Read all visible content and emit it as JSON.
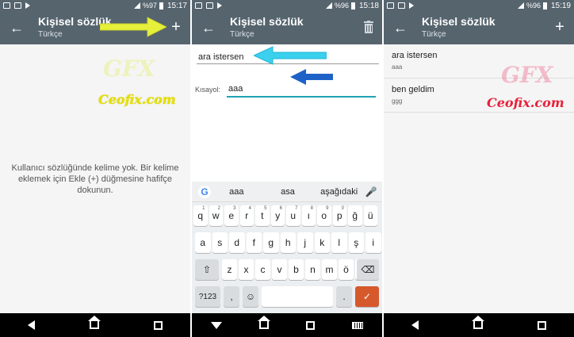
{
  "screens": [
    {
      "status": {
        "battery": "%97",
        "time": "15:17"
      },
      "title": "Kişisel sözlük",
      "subtitle": "Türkçe",
      "action": "+",
      "empty_message": "Kullanıcı sözlüğünde kelime yok. Bir kelime eklemek için Ekle (+) düğmesine hafifçe dokunun."
    },
    {
      "status": {
        "battery": "%96",
        "time": "15:18"
      },
      "title": "Kişisel sözlük",
      "subtitle": "Türkçe",
      "word_value": "ara istersen",
      "shortcut_label": "Kısayol:",
      "shortcut_value": "aaa",
      "suggestions": [
        "aaa",
        "asa",
        "aşağıdaki"
      ],
      "keyboard": {
        "row1": [
          "q",
          "w",
          "e",
          "r",
          "t",
          "y",
          "u",
          "ı",
          "o",
          "p",
          "ğ",
          "ü"
        ],
        "row1_hints": [
          "1",
          "2",
          "3",
          "4",
          "5",
          "6",
          "7",
          "8",
          "9",
          "0",
          "",
          ""
        ],
        "row2": [
          "a",
          "s",
          "d",
          "f",
          "g",
          "h",
          "j",
          "k",
          "l",
          "ş",
          "i"
        ],
        "row3": [
          "z",
          "x",
          "c",
          "v",
          "b",
          "n",
          "m",
          "ö",
          "ç"
        ],
        "symbols": "?123",
        "comma": ",",
        "period": "."
      }
    },
    {
      "status": {
        "battery": "%96",
        "time": "15:19"
      },
      "title": "Kişisel sözlük",
      "subtitle": "Türkçe",
      "action": "+",
      "entries": [
        {
          "word": "ara istersen",
          "shortcut": "aaa"
        },
        {
          "word": "ben geldim",
          "shortcut": "ggg"
        }
      ]
    }
  ],
  "watermark": {
    "logo": "GFX",
    "site": "Ceofix.com"
  },
  "colors": {
    "appbar": "#56646e",
    "accent": "#1fa3b6",
    "arrow_yellow": "#e6ef3a",
    "arrow_cyan": "#3ad0ee",
    "arrow_blue": "#1e62c8",
    "enter_key": "#d6592c"
  }
}
